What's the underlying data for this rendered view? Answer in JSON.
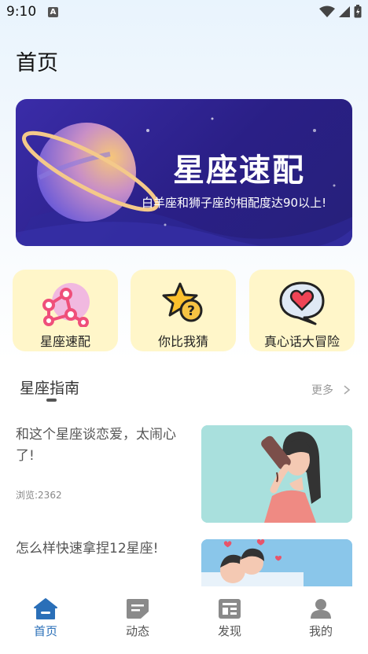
{
  "status": {
    "time": "9:10",
    "notification_icon": "A"
  },
  "header": {
    "title": "首页"
  },
  "banner": {
    "title": "星座速配",
    "subtitle": "白羊座和狮子座的相配度达90以上!"
  },
  "features": [
    {
      "label": "星座速配",
      "icon": "constellation-icon"
    },
    {
      "label": "你比我猜",
      "icon": "star-question-icon"
    },
    {
      "label": "真心话大冒险",
      "icon": "heart-bubble-icon"
    }
  ],
  "guide": {
    "title": "星座指南",
    "more_label": "更多"
  },
  "articles": [
    {
      "title": "和这个星座谈恋爱，太闹心了!",
      "views": "浏览:2362"
    },
    {
      "title": "怎么样快速拿捏12星座!"
    }
  ],
  "nav": [
    {
      "label": "首页",
      "icon": "home-icon"
    },
    {
      "label": "动态",
      "icon": "feed-icon"
    },
    {
      "label": "发现",
      "icon": "discover-icon"
    },
    {
      "label": "我的",
      "icon": "profile-icon"
    }
  ],
  "colors": {
    "accent": "#2a6fb8",
    "card_bg": "#fff6c9",
    "banner_bg": "#2e2290"
  }
}
